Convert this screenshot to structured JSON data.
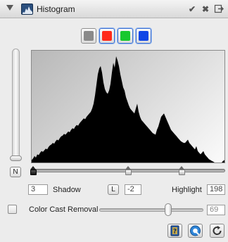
{
  "panel": {
    "title": "Histogram",
    "icons": {
      "disclosure": "disclosure-triangle-icon",
      "panel": "histogram-icon",
      "check": "checkmark-icon",
      "close": "close-icon",
      "menu": "panel-menu-icon"
    },
    "check_glyph": "✔",
    "close_glyph": "✖"
  },
  "channels": [
    {
      "name": "luminance",
      "color": "#8a8a8a"
    },
    {
      "name": "red",
      "color": "#ff2a1a"
    },
    {
      "name": "green",
      "color": "#18c82e"
    },
    {
      "name": "blue",
      "color": "#1046e6"
    }
  ],
  "histogram": {
    "fill_color": "#000000",
    "bins": [
      3,
      5,
      8,
      6,
      10,
      9,
      12,
      14,
      13,
      15,
      17,
      16,
      19,
      21,
      22,
      24,
      23,
      26,
      28,
      27,
      30,
      32,
      33,
      35,
      34,
      36,
      38,
      37,
      40,
      42,
      41,
      44,
      46,
      45,
      48,
      50,
      52,
      54,
      53,
      56,
      58,
      60,
      62,
      66,
      72,
      82,
      95,
      108,
      115,
      118,
      110,
      98,
      90,
      86,
      84,
      88,
      96,
      110,
      122,
      116,
      130,
      125,
      118,
      108,
      100,
      92,
      88,
      80,
      75,
      70,
      66,
      64,
      62,
      60,
      66,
      72,
      62,
      56,
      52,
      50,
      48,
      46,
      44,
      42,
      40,
      38,
      36,
      35,
      34,
      40,
      44,
      50,
      56,
      58,
      60,
      56,
      52,
      48,
      44,
      40,
      38,
      36,
      34,
      32,
      30,
      28,
      26,
      25,
      24,
      24,
      26,
      28,
      24,
      22,
      20,
      18,
      16,
      20,
      14,
      12,
      10,
      12,
      14,
      10,
      8,
      6,
      4,
      3,
      2,
      1,
      0,
      0,
      0,
      0,
      0,
      0,
      2,
      3
    ]
  },
  "buttons": {
    "n_label": "N",
    "l_label": "L"
  },
  "levels": {
    "shadow_label": "Shadow",
    "shadow_value": "3",
    "gamma_value": "-2",
    "highlight_label": "Highlight",
    "highlight_value": "198",
    "shadow": 3,
    "gamma": 128,
    "highlight": 198,
    "range_max": 255
  },
  "color_cast": {
    "label": "Color Cast Removal",
    "value": "69",
    "enabled": false
  },
  "bottom_icons": [
    "help-book-icon",
    "preview-icon",
    "reset-icon"
  ]
}
